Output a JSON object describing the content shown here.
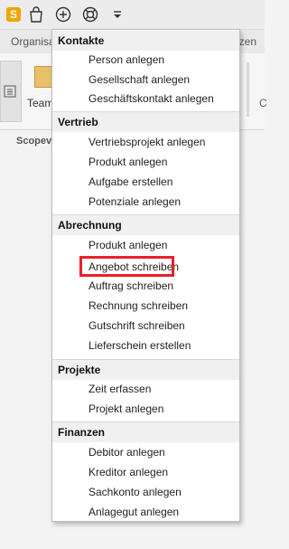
{
  "toolbar": {
    "icons": [
      "app-logo-icon",
      "bag-icon",
      "plus-circle-icon",
      "lifebuoy-icon",
      "dropdown-arrow-icon"
    ],
    "app_logo_letter": "S",
    "brand_color": "#f2a400"
  },
  "background": {
    "tab_left_label": "Organisa",
    "tab_right_label": "nzen",
    "team_label": "Team",
    "right_label": "C",
    "scope_label": "Scopev"
  },
  "menu": {
    "highlight_color": "#e8202a",
    "sections": [
      {
        "header": "Kontakte",
        "items": [
          "Person anlegen",
          "Gesellschaft anlegen",
          "Geschäftskontakt anlegen"
        ]
      },
      {
        "header": "Vertrieb",
        "items": [
          "Vertriebsprojekt anlegen",
          "Produkt anlegen",
          "Aufgabe erstellen",
          "Potenziale anlegen"
        ]
      },
      {
        "header": "Abrechnung",
        "items": [
          "Produkt anlegen",
          "Angebot schreiben",
          "Auftrag schreiben",
          "Rechnung schreiben",
          "Gutschrift schreiben",
          "Lieferschein erstellen"
        ]
      },
      {
        "header": "Projekte",
        "items": [
          "Zeit erfassen",
          "Projekt anlegen"
        ]
      },
      {
        "header": "Finanzen",
        "items": [
          "Debitor anlegen",
          "Kreditor anlegen",
          "Sachkonto anlegen",
          "Anlagegut anlegen"
        ]
      }
    ]
  }
}
